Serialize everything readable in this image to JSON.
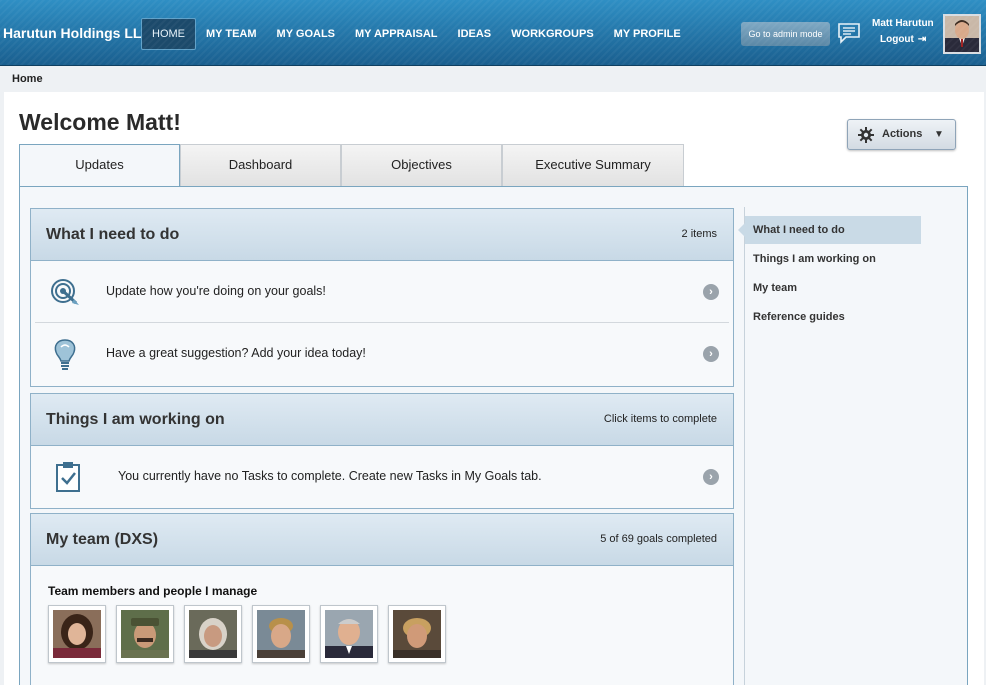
{
  "header": {
    "brand": "Harutun Holdings LLC",
    "nav": [
      {
        "label": "HOME",
        "active": true
      },
      {
        "label": "MY TEAM"
      },
      {
        "label": "MY GOALS"
      },
      {
        "label": "MY APPRAISAL"
      },
      {
        "label": "IDEAS"
      },
      {
        "label": "WORKGROUPS"
      },
      {
        "label": "MY PROFILE"
      }
    ],
    "admin_button": "Go to admin mode",
    "user_name": "Matt Harutun",
    "logout": "Logout"
  },
  "breadcrumb": "Home",
  "page": {
    "title": "Welcome Matt!",
    "actions_label": "Actions",
    "tabs": [
      "Updates",
      "Dashboard",
      "Objectives",
      "Executive Summary"
    ]
  },
  "sections": {
    "todo": {
      "title": "What I need to do",
      "meta": "2 items",
      "rows": [
        {
          "text": "Update how you're doing on your goals!",
          "icon": "target-icon"
        },
        {
          "text": "Have a great suggestion? Add your idea today!",
          "icon": "lightbulb-icon"
        }
      ]
    },
    "working": {
      "title": "Things I am working on",
      "meta": "Click items to complete",
      "rows": [
        {
          "text": "You currently have no Tasks to complete. Create new Tasks in My Goals tab.",
          "icon": "clipboard-icon"
        }
      ]
    },
    "team": {
      "title": "My team (DXS)",
      "meta": "5 of 69 goals completed",
      "label": "Team members and people I manage"
    }
  },
  "sidebar": [
    "What I need to do",
    "Things I am working on",
    "My team",
    "Reference guides"
  ],
  "colors": {
    "header": "#1f6a9b",
    "section_head": "#d3e2ed",
    "accent_border": "#7aa5bf"
  }
}
